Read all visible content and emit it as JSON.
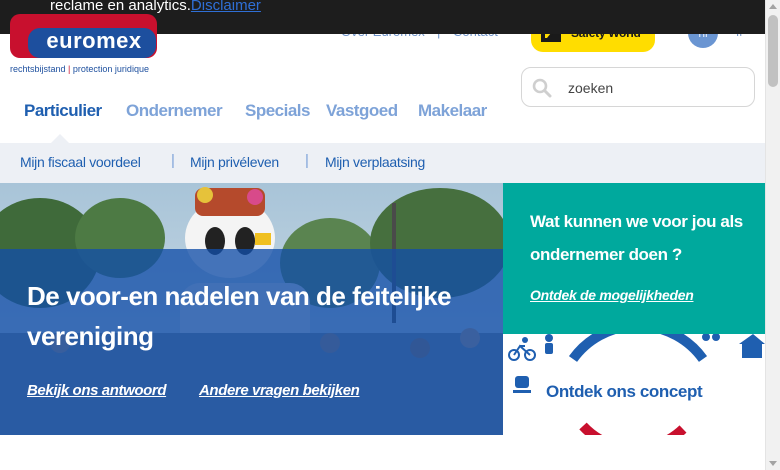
{
  "cookie_bar": {
    "text": "reclame en analytics.",
    "link": "Disclaimer"
  },
  "header": {
    "logo_word": "euromex",
    "logo_tagline_left": "rechtsbijstand",
    "logo_tagline_sep": "|",
    "logo_tagline_right": "protection juridique",
    "top_links": [
      "Over Euromex",
      "Contact"
    ],
    "top_separator": "|",
    "safety_world": "Safety World",
    "lang_active": "nl",
    "lang_other": "fr",
    "search_placeholder": "zoeken"
  },
  "main_nav": {
    "items": [
      {
        "label": "Particulier"
      },
      {
        "label": "Ondernemer"
      },
      {
        "label": "Specials"
      },
      {
        "label": "Vastgoed"
      },
      {
        "label": "Makelaar"
      }
    ],
    "active": "Particulier"
  },
  "sub_nav": {
    "items": [
      {
        "label": "Mijn fiscaal voordeel"
      },
      {
        "label": "Mijn privéleven"
      },
      {
        "label": "Mijn verplaatsing"
      }
    ],
    "separator": "|"
  },
  "hero": {
    "title": "De voor-en nadelen van de feitelijke vereniging",
    "links": [
      "Bekijk ons antwoord",
      "Andere vragen bekijken"
    ]
  },
  "teal_panel": {
    "title": "Wat kunnen we voor jou als ondernemer doen ?",
    "link": "Ontdek de mogelijkheden"
  },
  "concept_panel": {
    "label": "Ontdek ons concept"
  },
  "colors": {
    "brand_red": "#c8102e",
    "brand_blue": "#1d4f9e",
    "nav_active": "#1f5fb0",
    "nav_inactive": "#7ea3d8",
    "teal": "#00a99d",
    "safety_yellow": "#ffdd00",
    "cookie_bg": "#1d1d1d"
  }
}
